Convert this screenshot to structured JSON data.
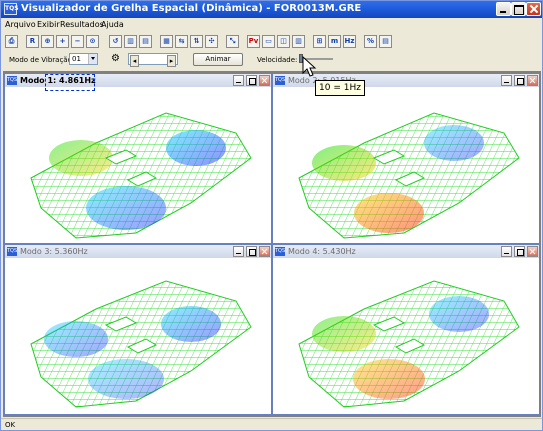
{
  "window": {
    "title": "Visualizador de Grelha Espacial (Dinâmica) - FOR0013M.GRE",
    "icon_text": "TQS"
  },
  "menu": [
    {
      "label": "Arquivo"
    },
    {
      "label": "Exibir"
    },
    {
      "label": "Resultados"
    },
    {
      "label": "Ajuda"
    }
  ],
  "toolbar": {
    "buttons": [
      {
        "icon": "print-icon",
        "glyph": "⎙"
      },
      {
        "icon": "r-icon",
        "glyph": "R"
      },
      {
        "icon": "zoom-window-icon",
        "glyph": "⊕"
      },
      {
        "icon": "zoom-in-icon",
        "glyph": "+"
      },
      {
        "icon": "zoom-out-icon",
        "glyph": "−"
      },
      {
        "icon": "zoom-all-icon",
        "glyph": "⊙"
      },
      {
        "icon": "zoom-previous-icon",
        "glyph": "↺"
      },
      {
        "icon": "view-front-icon",
        "glyph": "▥"
      },
      {
        "icon": "view-side-icon",
        "glyph": "▤"
      },
      {
        "icon": "view-top-icon",
        "glyph": "▦"
      },
      {
        "icon": "rotate-left-icon",
        "glyph": "⇆"
      },
      {
        "icon": "rotate-up-icon",
        "glyph": "⇅"
      },
      {
        "icon": "rotate-x-icon",
        "glyph": "✣"
      },
      {
        "icon": "rotate-free-icon",
        "glyph": "⤡"
      },
      {
        "icon": "pv-icon",
        "glyph": "Pv"
      },
      {
        "icon": "layout-1-icon",
        "glyph": "▭"
      },
      {
        "icon": "layout-2-icon",
        "glyph": "◫"
      },
      {
        "icon": "layout-3-icon",
        "glyph": "▥"
      },
      {
        "icon": "layout-4-icon",
        "glyph": "⊞"
      },
      {
        "icon": "mode-m-icon",
        "glyph": "m"
      },
      {
        "icon": "mode-hz-icon",
        "glyph": "Hz"
      },
      {
        "icon": "percent-icon",
        "glyph": "%"
      },
      {
        "icon": "report-icon",
        "glyph": "▤"
      }
    ]
  },
  "controls": {
    "mode_label": "Modo de Vibração:",
    "mode_value": "01",
    "animate_label": "Animar",
    "speed_label": "Velocidade:",
    "tooltip": "10 = 1Hz",
    "speed_level": 0.0
  },
  "panes": [
    {
      "title": "Modo 1: 4.861Hz",
      "active": true
    },
    {
      "title": "Modo 2: 5.015Hz",
      "active": false
    },
    {
      "title": "Modo 3: 5.360Hz",
      "active": false
    },
    {
      "title": "Modo 4: 5.430Hz",
      "active": false
    }
  ],
  "status": {
    "text": "OK"
  },
  "colors": {
    "title_bar": "#1a56d6",
    "mesh_low": "#00e000",
    "mesh_mid": "#ffff00",
    "mesh_high": "#ff0000",
    "mesh_alt": "#0000ff"
  }
}
